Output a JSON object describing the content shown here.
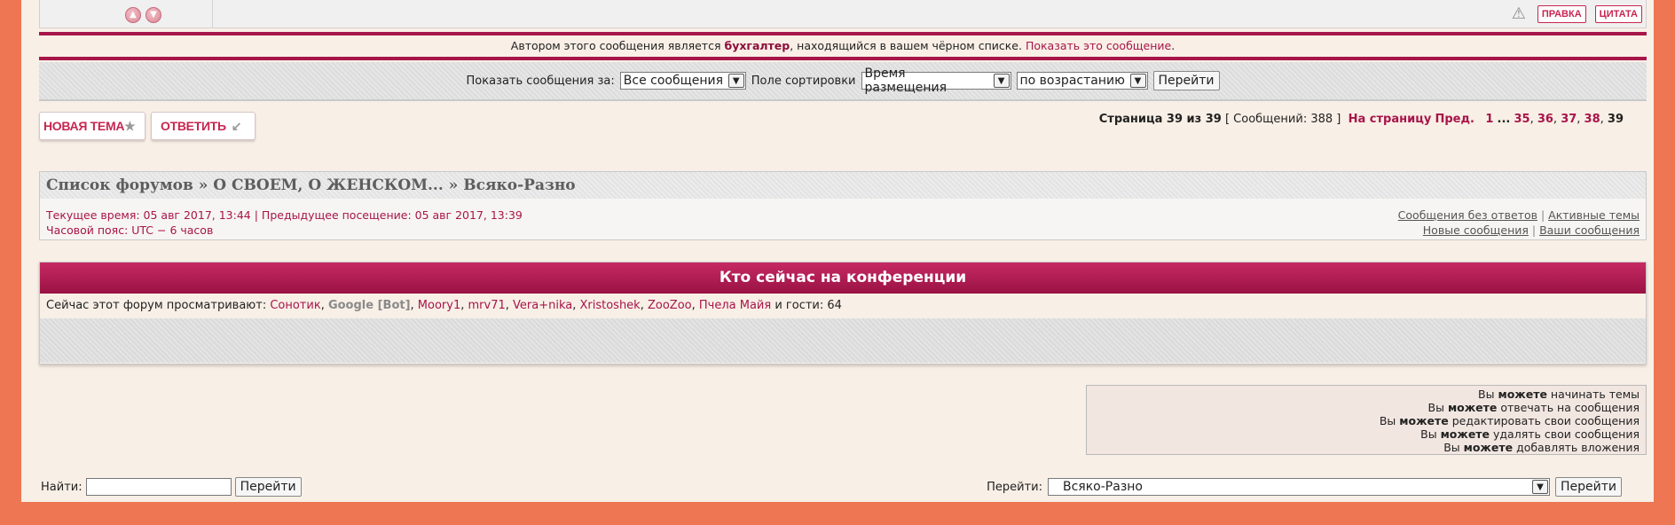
{
  "post_actions": {
    "report_label": "!",
    "edit_label": "ПРАВКА",
    "quote_label": "ЦИТАТА"
  },
  "blocked_notice": {
    "prefix": "Автором этого сообщения является ",
    "author": "бухгалтер",
    "middle": ", находящийся в вашем чёрном списке. ",
    "link": "Показать это сообщение",
    "suffix": "."
  },
  "sort_bar": {
    "show_label": "Показать сообщения за:",
    "show_value": "Все сообщения",
    "sort_label": "Поле сортировки",
    "sort_value": "Время размещения",
    "order_value": "по возрастанию",
    "go_label": "Перейти"
  },
  "buttons": {
    "new_topic": "НОВАЯ ТЕМА",
    "reply": "ОТВЕТИТЬ"
  },
  "pagination": {
    "page_info": "Страница 39 из 39",
    "post_count": "[ Сообщений: 388 ]",
    "goto_label": "На страницу",
    "prev_label": "Пред.",
    "pages": [
      "1",
      "...",
      "35",
      "36",
      "37",
      "38",
      "39"
    ]
  },
  "breadcrumb": {
    "text": "Список форумов » О СВОЕМ, О ЖЕНСКОМ... » Всяко-Разно"
  },
  "times": {
    "current": "Текущее время: 05 авг 2017, 13:44 | Предыдущее посещение: 05 авг 2017, 13:39",
    "timezone": "Часовой пояс: UTC − 6 часов"
  },
  "quicklinks": {
    "unanswered": "Сообщения без ответов",
    "active": "Активные темы",
    "new_posts": "Новые сообщения",
    "your_posts": "Ваши сообщения"
  },
  "online": {
    "title": "Кто сейчас на конференции",
    "prefix": "Сейчас этот форум просматривают: ",
    "users": [
      "Сонотик",
      "Google [Bot]",
      "Moory1",
      "mrv71",
      "Vera+nika",
      "Xristoshek",
      "ZooZoo",
      "Пчела Майя"
    ],
    "guests": " и гости: 64"
  },
  "permissions": {
    "you": "Вы",
    "can": "можете",
    "items": [
      "начинать темы",
      "отвечать на сообщения",
      "редактировать свои сообщения",
      "удалять свои сообщения",
      "добавлять вложения"
    ]
  },
  "search": {
    "label": "Найти:",
    "value": "",
    "go_label": "Перейти"
  },
  "jump": {
    "label": "Перейти:",
    "value": "Всяко-Разно",
    "go_label": "Перейти"
  }
}
